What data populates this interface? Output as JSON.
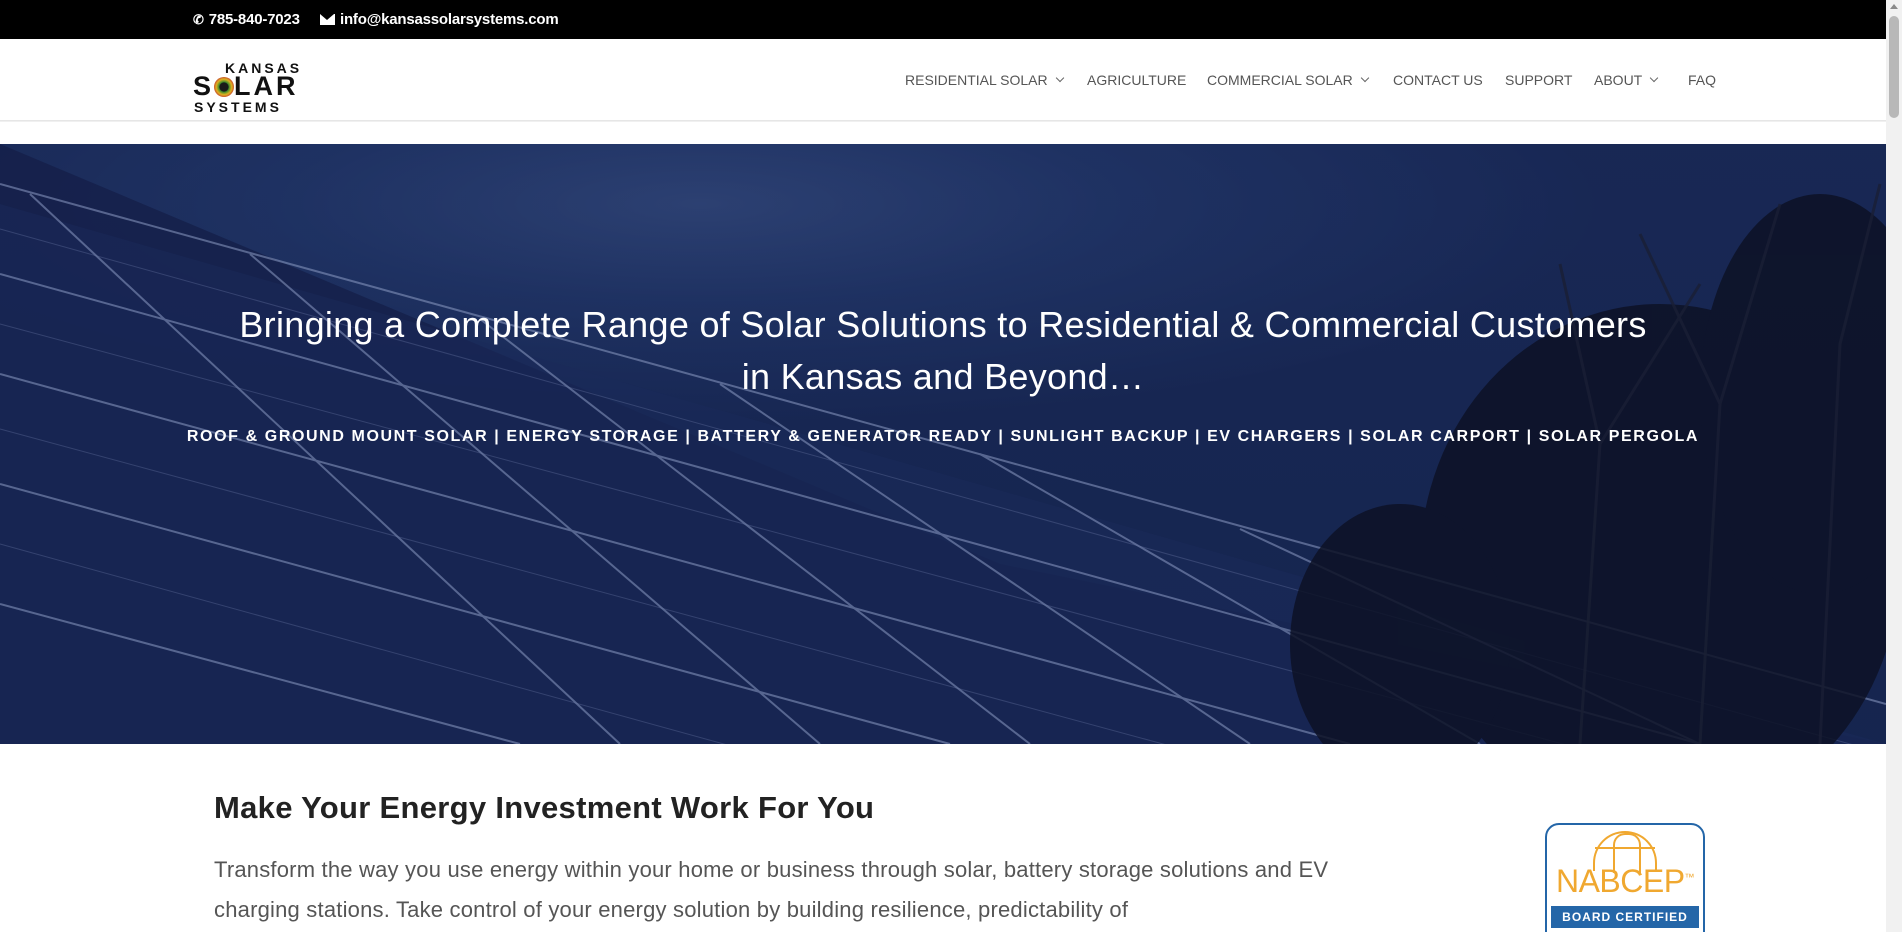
{
  "topbar": {
    "phone": "785-840-7023",
    "email": "info@kansassolarsystems.com"
  },
  "logo": {
    "line1": "KANSAS",
    "line2_pre": "S",
    "line2_post": "LAR",
    "line3": "SYSTEMS"
  },
  "nav": {
    "items": [
      {
        "label": "RESIDENTIAL SOLAR",
        "has_dropdown": true
      },
      {
        "label": "AGRICULTURE",
        "has_dropdown": false
      },
      {
        "label": "COMMERCIAL SOLAR",
        "has_dropdown": true
      },
      {
        "label": "CONTACT US",
        "has_dropdown": false
      },
      {
        "label": "SUPPORT",
        "has_dropdown": false
      },
      {
        "label": "ABOUT",
        "has_dropdown": true
      },
      {
        "label": "FAQ",
        "has_dropdown": false
      }
    ]
  },
  "hero": {
    "title_line1": "Bringing a Complete Range of Solar Solutions to Residential & Commercial Customers",
    "title_line2": "in Kansas and Beyond…",
    "subtitle": "ROOF & GROUND MOUNT SOLAR | ENERGY STORAGE | BATTERY & GENERATOR READY  | SUNLIGHT BACKUP | EV CHARGERS | SOLAR CARPORT | SOLAR PERGOLA"
  },
  "content": {
    "heading": "Make Your Energy Investment Work For You",
    "paragraph": "Transform the way you use energy within your home or business through solar, battery storage solutions and EV charging stations. Take control of your energy solution by building resilience, predictability of"
  },
  "badge": {
    "name": "NABCEP",
    "tm": "™",
    "caption": "BOARD CERTIFIED"
  },
  "colors": {
    "topbar_bg": "#000000",
    "nav_text": "#555555",
    "hero_overlay": "#1d3366",
    "badge_blue": "#2466a8",
    "badge_orange": "#f0a830"
  }
}
